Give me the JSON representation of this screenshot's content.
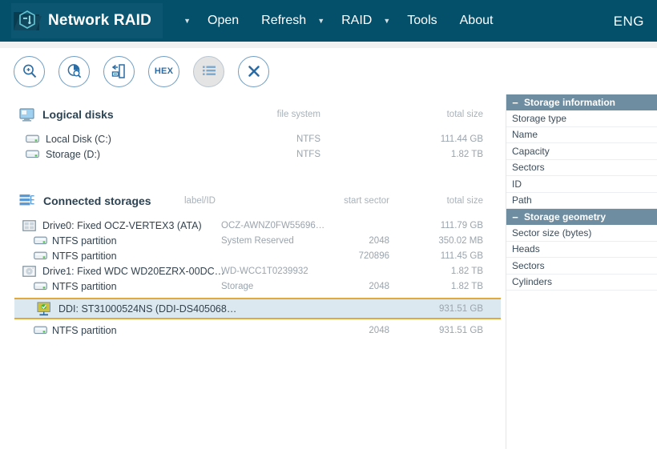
{
  "app": {
    "title": "Network RAID",
    "logo_icon": "hex-folder-logo-icon",
    "language": "ENG"
  },
  "menu": [
    {
      "label": "Open",
      "caret": "▼",
      "has_caret": true
    },
    {
      "label": "Refresh",
      "caret": "",
      "has_caret": false
    },
    {
      "label": "RAID",
      "caret": "▼",
      "has_caret": true
    },
    {
      "label": "Tools",
      "caret": "▼",
      "has_caret": true
    },
    {
      "label": "About",
      "caret": "",
      "has_caret": false
    }
  ],
  "toolbar": {
    "buttons": [
      {
        "name": "search-icon",
        "label": "",
        "active": false
      },
      {
        "name": "disk-scan-icon",
        "label": "",
        "active": false
      },
      {
        "name": "file-recovery-icon",
        "label": "",
        "active": false
      },
      {
        "name": "hex-viewer-icon",
        "label": "HEX",
        "active": false
      },
      {
        "name": "list-view-icon",
        "label": "",
        "active": true
      },
      {
        "name": "close-icon",
        "label": "",
        "active": false
      }
    ]
  },
  "logical_disks": {
    "title": "Logical disks",
    "icon": "monitor-icon",
    "columns": {
      "file_system": "file system",
      "total_size": "total size"
    },
    "rows": [
      {
        "icon": "drive-icon",
        "label": "Local Disk (C:)",
        "file_system": "NTFS",
        "total_size": "111.44 GB"
      },
      {
        "icon": "drive-icon",
        "label": "Storage (D:)",
        "file_system": "NTFS",
        "total_size": "1.82 TB"
      }
    ]
  },
  "connected_storages": {
    "title": "Connected storages",
    "icon": "storages-icon",
    "columns": {
      "label_id": "label/ID",
      "start_sector": "start sector",
      "total_size": "total size"
    },
    "rows": [
      {
        "icon": "ssd-icon",
        "indent": 0,
        "label": "Drive0: Fixed OCZ-VERTEX3 (ATA)",
        "label_id": "OCZ-AWNZ0FW55696…",
        "start_sector": "",
        "total_size": "111.79 GB",
        "selected": false
      },
      {
        "icon": "partition-icon",
        "indent": 1,
        "label": "NTFS partition",
        "label_id": "System Reserved",
        "start_sector": "2048",
        "total_size": "350.02 MB",
        "selected": false
      },
      {
        "icon": "partition-icon",
        "indent": 1,
        "label": "NTFS partition",
        "label_id": "",
        "start_sector": "720896",
        "total_size": "111.45 GB",
        "selected": false
      },
      {
        "icon": "hdd-icon",
        "indent": 0,
        "label": "Drive1: Fixed WDC WD20EZRX-00DC…",
        "label_id": "WD-WCC1T0239932",
        "start_sector": "",
        "total_size": "1.82 TB",
        "selected": false
      },
      {
        "icon": "partition-icon",
        "indent": 1,
        "label": "NTFS partition",
        "label_id": "Storage",
        "start_sector": "2048",
        "total_size": "1.82 TB",
        "selected": false
      },
      {
        "icon": "ddi-icon",
        "indent": 0,
        "label": "DDI: ST31000524NS (DDI-DS405068…",
        "label_id": "",
        "start_sector": "",
        "total_size": "931.51 GB",
        "selected": true
      },
      {
        "icon": "partition-icon",
        "indent": 1,
        "label": "NTFS partition",
        "label_id": "",
        "start_sector": "2048",
        "total_size": "931.51 GB",
        "selected": false
      }
    ]
  },
  "sidebar": {
    "sections": [
      {
        "title": "Storage information",
        "collapse_glyph": "−",
        "rows": [
          {
            "label": "Storage type",
            "value": ""
          },
          {
            "label": "Name",
            "value": ""
          },
          {
            "label": "Capacity",
            "value": ""
          },
          {
            "label": "Sectors",
            "value": ""
          },
          {
            "label": "ID",
            "value": ""
          },
          {
            "label": "Path",
            "value": ""
          }
        ]
      },
      {
        "title": "Storage geometry",
        "collapse_glyph": "−",
        "rows": [
          {
            "label": "Sector size (bytes)",
            "value": ""
          },
          {
            "label": "Heads",
            "value": ""
          },
          {
            "label": "Sectors",
            "value": ""
          },
          {
            "label": "Cylinders",
            "value": ""
          }
        ]
      }
    ]
  },
  "colors": {
    "header_bg": "#04506b",
    "accent_blue": "#6f9ec4",
    "sidebar_header_bg": "#6f8da1",
    "selection_fill": "#dce8ef",
    "selection_border": "#e2a93e",
    "muted_text": "#9aa4ad"
  }
}
